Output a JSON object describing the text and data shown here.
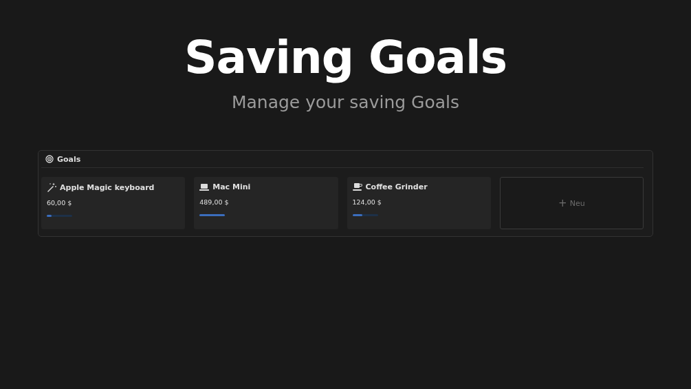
{
  "header": {
    "title": "Saving Goals",
    "subtitle": "Manage your saving Goals"
  },
  "panel": {
    "title": "Goals",
    "goals": [
      {
        "name": "Apple Magic keyboard",
        "amount": "60,00 $",
        "level": 0.2
      },
      {
        "name": "Mac Mini",
        "amount": "489,00 $",
        "level": 1
      },
      {
        "name": "Coffee Grinder",
        "amount": "124,00 $",
        "level": 0.4
      }
    ],
    "new_button": {
      "icon": "+",
      "label": "Neu"
    }
  }
}
